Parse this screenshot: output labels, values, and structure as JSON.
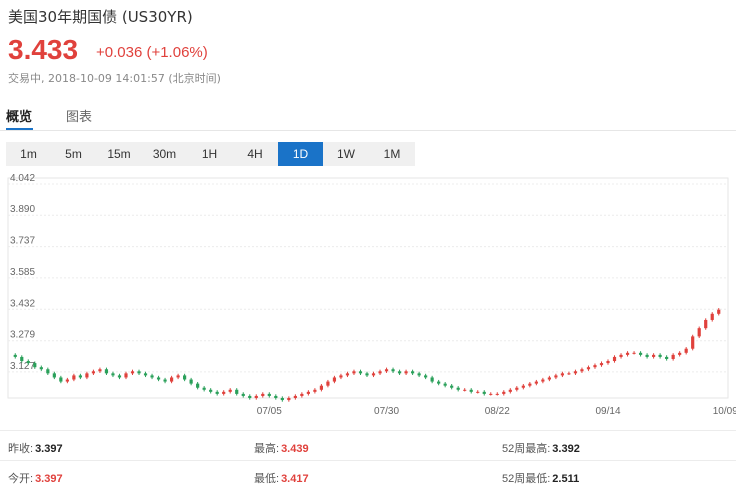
{
  "header": {
    "title": "美国30年期国债 (US30YR)",
    "price": "3.433",
    "change": "+0.036 (+1.06%)",
    "status": "交易中, 2018-10-09 14:01:57 (北京时间)"
  },
  "tabs": [
    "概览",
    "图表"
  ],
  "ranges": {
    "items": [
      "1m",
      "5m",
      "15m",
      "30m",
      "1H",
      "4H",
      "1D",
      "1W",
      "1M"
    ],
    "active": "1D"
  },
  "colors": {
    "up": "#e0413c",
    "down": "#2aa05a",
    "accent": "#1a73c8"
  },
  "chart_data": {
    "type": "candlestick",
    "y_ticks": [
      "4.042",
      "3.890",
      "3.737",
      "3.585",
      "3.432",
      "3.279",
      "3.127"
    ],
    "ylim": [
      3.0,
      4.042
    ],
    "x_ticks": [
      {
        "label": "07/05",
        "index": 39
      },
      {
        "label": "07/30",
        "index": 57
      },
      {
        "label": "08/22",
        "index": 74
      },
      {
        "label": "09/14",
        "index": 91
      },
      {
        "label": "10/09",
        "index": 109
      }
    ],
    "series": [
      {
        "values": [
          3.2,
          3.18,
          3.17,
          3.15,
          3.14,
          3.12,
          3.1,
          3.08,
          3.09,
          3.11,
          3.1,
          3.12,
          3.13,
          3.14,
          3.12,
          3.11,
          3.1,
          3.12,
          3.13,
          3.12,
          3.11,
          3.1,
          3.09,
          3.08,
          3.1,
          3.11,
          3.09,
          3.07,
          3.05,
          3.04,
          3.03,
          3.02,
          3.03,
          3.04,
          3.02,
          3.01,
          3.0,
          3.01,
          3.02,
          3.01,
          3.0,
          2.99,
          3.0,
          3.01,
          3.02,
          3.03,
          3.04,
          3.06,
          3.08,
          3.1,
          3.11,
          3.12,
          3.13,
          3.12,
          3.11,
          3.12,
          3.13,
          3.14,
          3.13,
          3.12,
          3.13,
          3.12,
          3.11,
          3.1,
          3.08,
          3.07,
          3.06,
          3.05,
          3.04,
          3.04,
          3.03,
          3.03,
          3.02,
          3.02,
          3.02,
          3.03,
          3.04,
          3.05,
          3.06,
          3.07,
          3.08,
          3.09,
          3.1,
          3.11,
          3.12,
          3.12,
          3.13,
          3.14,
          3.15,
          3.16,
          3.17,
          3.18,
          3.2,
          3.21,
          3.22,
          3.22,
          3.21,
          3.2,
          3.21,
          3.2,
          3.19,
          3.21,
          3.22,
          3.24,
          3.3,
          3.34,
          3.38,
          3.41,
          3.43
        ]
      }
    ]
  },
  "stats": {
    "prev_close_label": "昨收:",
    "prev_close": "3.397",
    "open_label": "今开:",
    "open": "3.397",
    "high_label": "最高:",
    "high": "3.439",
    "low_label": "最低:",
    "low": "3.417",
    "high52_label": "52周最高:",
    "high52": "3.392",
    "low52_label": "52周最低:",
    "low52": "2.511"
  }
}
